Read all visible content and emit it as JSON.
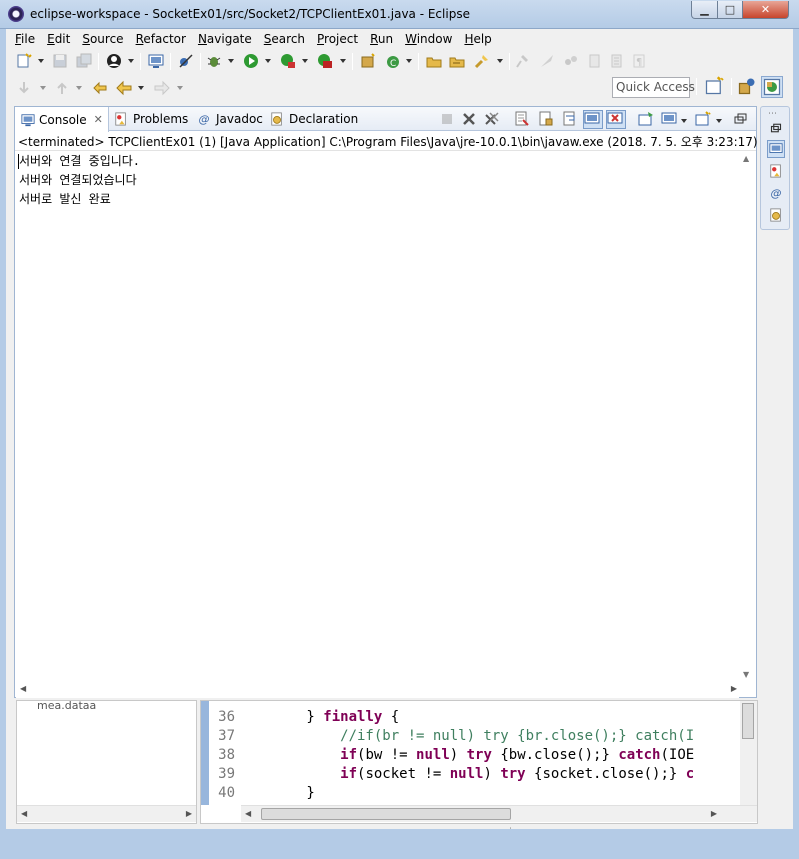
{
  "window": {
    "title": "eclipse-workspace - SocketEx01/src/Socket2/TCPClientEx01.java - Eclipse",
    "minimize_glyph": "▁",
    "maximize_glyph": "□",
    "close_glyph": "✕"
  },
  "menubar": {
    "items": [
      "File",
      "Edit",
      "Source",
      "Refactor",
      "Navigate",
      "Search",
      "Project",
      "Run",
      "Window",
      "Help"
    ]
  },
  "toolbar": {
    "quick_access_placeholder": "Quick Access"
  },
  "console_view": {
    "tabs": [
      {
        "label": "Console",
        "icon": "console-icon",
        "active": true
      },
      {
        "label": "Problems",
        "icon": "problems-icon",
        "active": false
      },
      {
        "label": "Javadoc",
        "icon": "javadoc-icon",
        "active": false
      },
      {
        "label": "Declaration",
        "icon": "declaration-icon",
        "active": false
      }
    ],
    "close_glyph": "✕",
    "at_glyph": "@",
    "description": "<terminated> TCPClientEx01 (1) [Java Application] C:\\Program Files\\Java\\jre-10.0.1\\bin\\javaw.exe (2018. 7. 5. 오후 3:23:17)",
    "output_lines": [
      "서버와 연결 중입니다.",
      "서버와 연결되었습니다",
      "서버로 발신 완료"
    ]
  },
  "editor": {
    "lines": [
      {
        "number": "36"
      },
      {
        "number": "37"
      },
      {
        "number": "38"
      },
      {
        "number": "39"
      },
      {
        "number": "40"
      }
    ],
    "code": {
      "l36_a": "        } ",
      "l36_kw": "finally",
      "l36_b": " {",
      "l37_cm": "            //if(br != null) try {br.close();} catch(I",
      "l38_kw1": "if",
      "l38_a": "(bw != ",
      "l38_kw2": "null",
      "l38_b": ") ",
      "l38_kw3": "try",
      "l38_c": " {bw.close();} ",
      "l38_kw4": "catch",
      "l38_d": "(IOE",
      "l39_kw1": "if",
      "l39_a": "(socket != ",
      "l39_kw2": "null",
      "l39_b": ") ",
      "l39_kw3": "try",
      "l39_c": " {socket.close();} ",
      "l39_kw4": "c",
      "l40_a": "        }",
      "indent": "            "
    }
  },
  "tree_view": {
    "partial_item": "mea.dataa"
  },
  "colors": {
    "keyword": "#7f0055",
    "comment": "#3f7f5f",
    "line_number": "#787878",
    "selection_blue": "#cfe0f4"
  }
}
